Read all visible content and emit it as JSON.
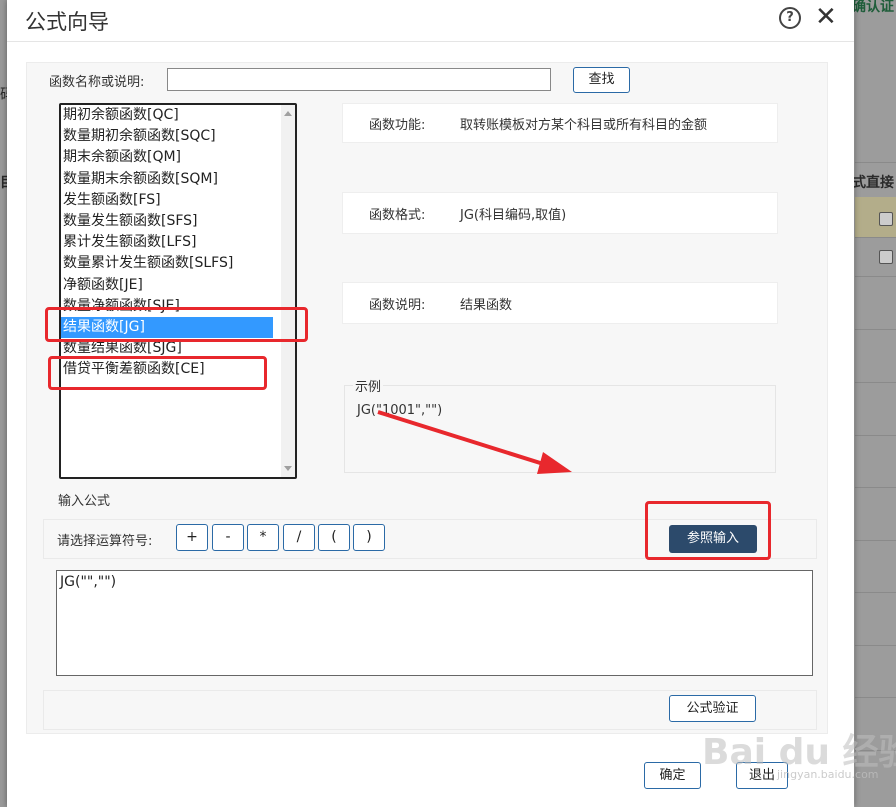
{
  "background_app": {
    "top_right_link": "确认证",
    "header_fragment": "式直接",
    "left_fragment_1": "目",
    "left_fragment_2": "码"
  },
  "dialog": {
    "title": "公式向导",
    "help_icon": "question-circle-icon",
    "close_icon": "close-icon"
  },
  "search": {
    "label": "函数名称或说明:",
    "value": "",
    "button": "查找"
  },
  "function_list": {
    "items": [
      "期初余额函数[QC]",
      "数量期初余额函数[SQC]",
      "期末余额函数[QM]",
      "数量期末余额函数[SQM]",
      "发生额函数[FS]",
      "数量发生额函数[SFS]",
      "累计发生额函数[LFS]",
      "数量累计发生额函数[SLFS]",
      "净额函数[JE]",
      "数量净额函数[SJE]",
      "结果函数[JG]",
      "数量结果函数[SJG]",
      "借贷平衡差额函数[CE]"
    ],
    "selected_index": 10
  },
  "function_info": {
    "feature_label": "函数功能:",
    "feature_value": "取转账模板对方某个科目或所有科目的金额",
    "format_label": "函数格式:",
    "format_value": "JG(科目编码,取值)",
    "desc_label": "函数说明:",
    "desc_value": "结果函数"
  },
  "example": {
    "legend": "示例",
    "text": "JG(\"1001\",\"\")"
  },
  "formula": {
    "section_label": "输入公式",
    "operator_label": "请选择运算符号:",
    "operators": [
      "+",
      "-",
      "*",
      "/",
      "(",
      ")"
    ],
    "reference_button": "参照输入",
    "value": "JG(\"\",\"\")",
    "verify_button": "公式验证"
  },
  "footer": {
    "ok_button": "确定",
    "exit_button": "退出"
  },
  "watermark": {
    "text": "Bai du 经验",
    "sub": "jingyan.baidu.com"
  },
  "colors": {
    "selected_bg": "#3399ff",
    "reference_button_bg": "#2c4a6b",
    "annotation_red": "#e8282d",
    "button_border": "#2b6aa6"
  }
}
